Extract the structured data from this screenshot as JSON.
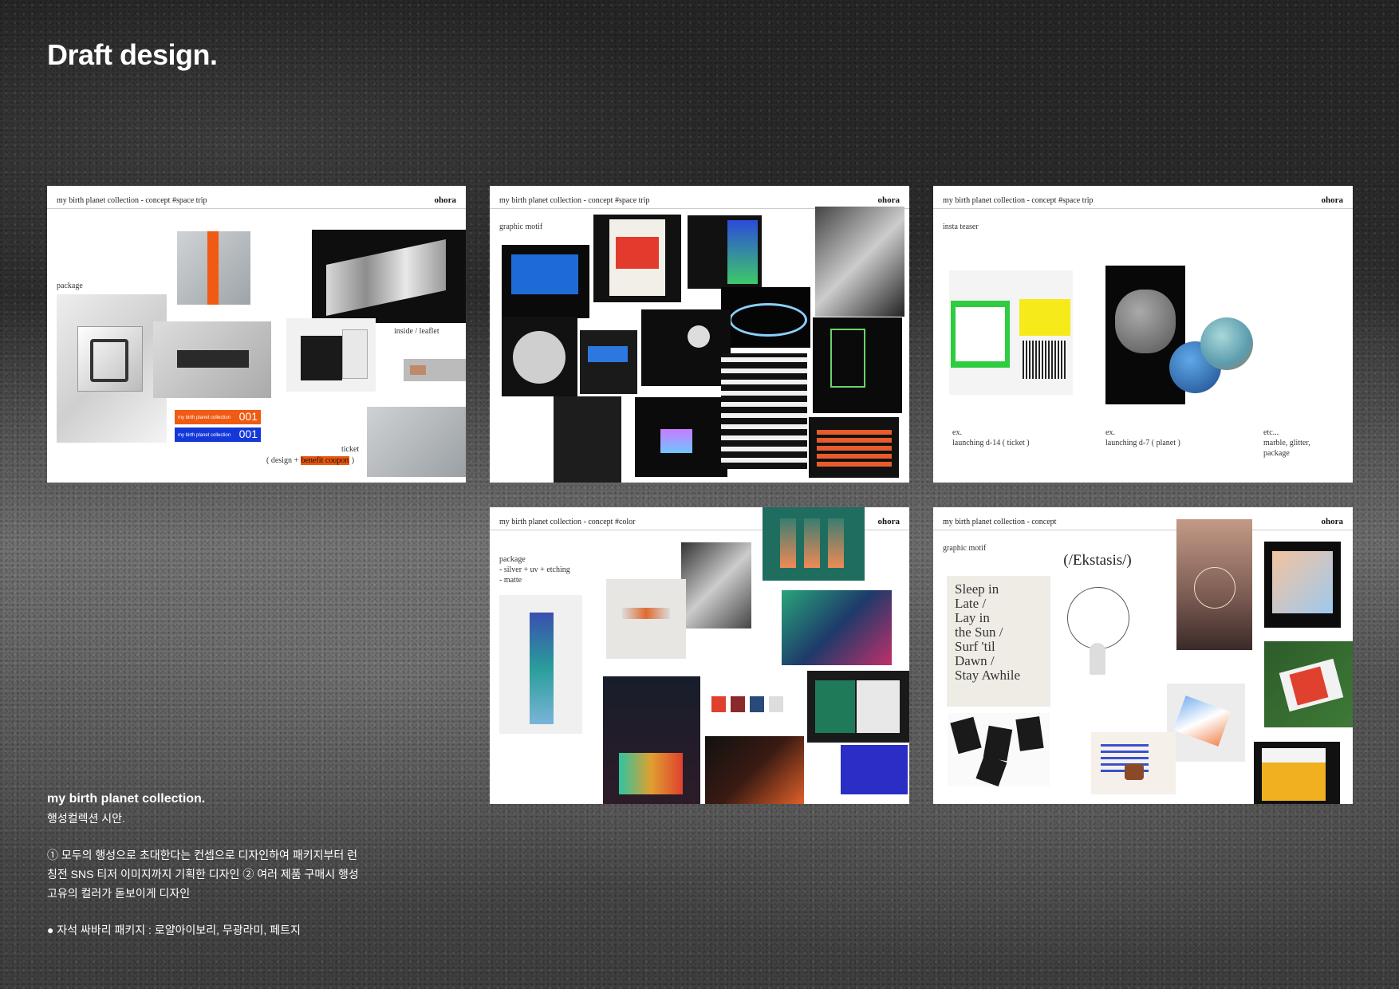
{
  "page": {
    "title": "Draft design."
  },
  "panels": [
    {
      "header": "my birth planet collection - concept #space trip",
      "brand": "ohora",
      "labels": {
        "package": "package",
        "inside": "inside / leaflet",
        "ticket": "ticket",
        "ticket_note_open": "( design + ",
        "ticket_note_hl": "benefit coupon",
        "ticket_note_close": " )"
      },
      "coupon_tag": "my birth planet collection",
      "coupon_num": "001"
    },
    {
      "header": "my birth planet collection - concept #space trip",
      "brand": "ohora",
      "labels": {
        "motif": "graphic motif"
      }
    },
    {
      "header": "my birth planet collection - concept #space trip",
      "brand": "ohora",
      "labels": {
        "teaser": "insta teaser",
        "ex1": "ex.",
        "ex1_text": "launching d-14 ( ticket )",
        "ex2": "ex.",
        "ex2_text": "launching d-7 ( planet )",
        "etc": "etc...",
        "etc_text1": "marble, glitter,",
        "etc_text2": "package"
      }
    },
    {
      "header": "my birth planet collection - concept #color",
      "brand": "ohora",
      "labels": {
        "package": "package",
        "l1": "- silver + uv + etching",
        "l2": "- matte"
      }
    },
    {
      "header": "my birth planet collection - concept",
      "brand": "ohora",
      "labels": {
        "motif": "graphic motif"
      },
      "poster_text": [
        "Sleep in",
        "Late /",
        "Lay in",
        "the Sun /",
        "Surf 'til",
        "Dawn /",
        "Stay Awhile"
      ],
      "ekstasis": "(/Ekstasis/)"
    }
  ],
  "description": {
    "heading": "my birth planet collection.",
    "subheading": "행성컬렉션 시안.",
    "lines": [
      "① 모두의 행성으로 초대한다는 컨셉으로 디자인하여 패키지부터 런",
      "칭전 SNS 티저 이미지까지 기획한 디자인 ② 여러 제품 구매시 행성",
      "고유의 컬러가 돋보이게 디자인"
    ],
    "bullet": "● 자석 싸바리 패키지 : 로얄아이보리, 무광라미, 페트지"
  }
}
